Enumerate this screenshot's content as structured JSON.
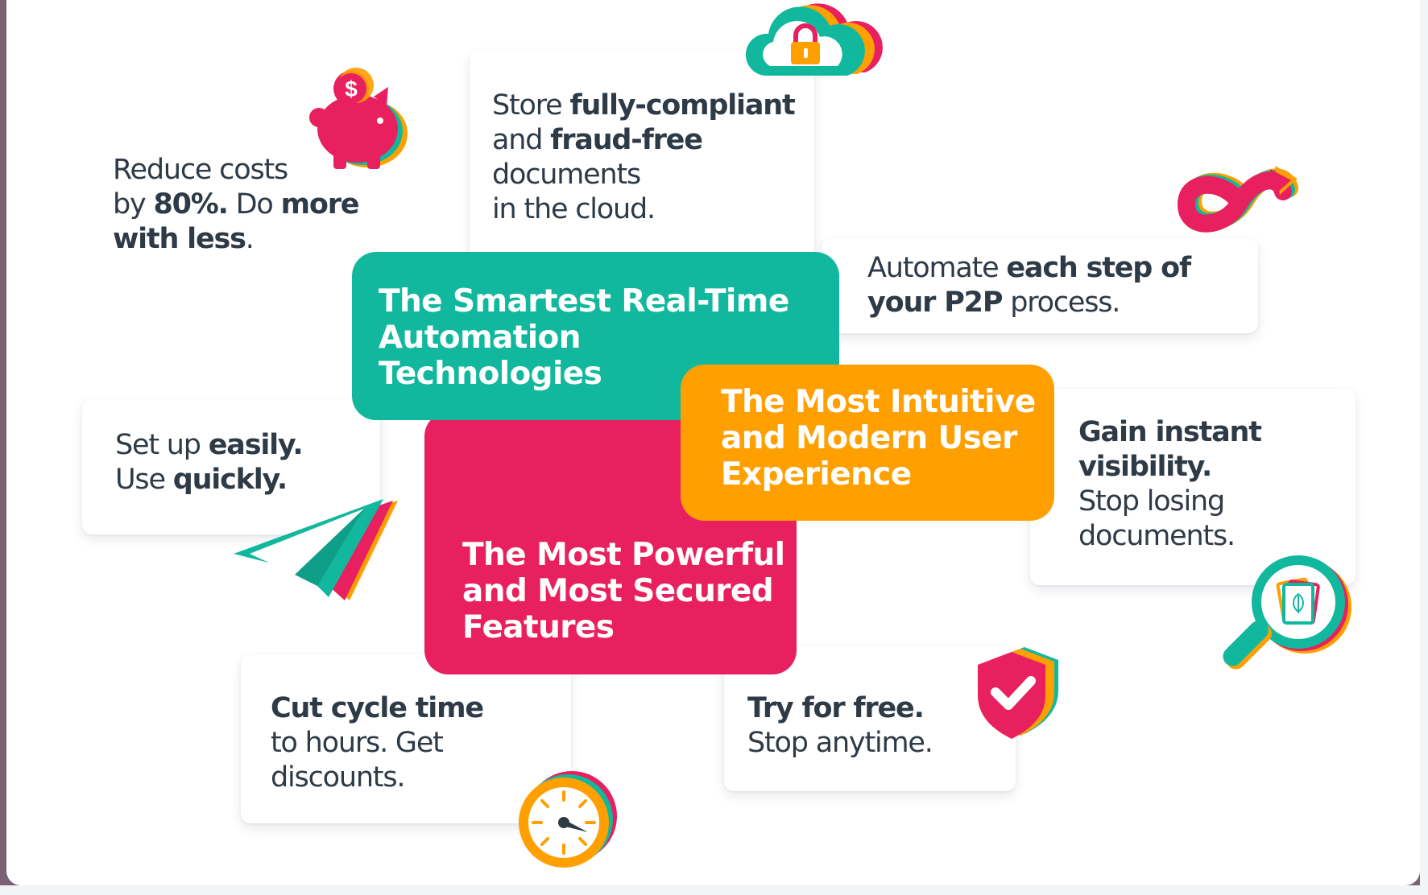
{
  "colors": {
    "teal": "#12b89d",
    "pink": "#e8205f",
    "orange": "#ff9f00",
    "text": "#2e3a46",
    "page_frame": "#7a6173"
  },
  "icons": [
    "piggy-bank-icon",
    "cloud-lock-icon",
    "infinity-arrow-icon",
    "paper-plane-icon",
    "magnifier-document-icon",
    "shield-check-icon",
    "speedometer-icon"
  ],
  "features": {
    "smartest": {
      "line1": "The Smartest Real-Time",
      "line2": "Automation",
      "line3": "Technologies"
    },
    "intuitive": {
      "line1": "The Most Intuitive",
      "line2": "and Modern User",
      "line3": "Experience"
    },
    "powerful": {
      "line1": "The Most Powerful",
      "line2": "and Most Secured",
      "line3": "Features"
    }
  },
  "benefits": {
    "reduce_costs": {
      "t1": "Reduce costs",
      "t2": "by ",
      "t3": "80%.",
      "t4": " Do ",
      "t5": "more",
      "t6": "with less",
      "t7": "."
    },
    "store": {
      "t1": "Store ",
      "t2": "fully-compliant",
      "t3": "and ",
      "t4": "fraud-free",
      "t5": "documents",
      "t6": "in the cloud."
    },
    "automate": {
      "t1": "Automate ",
      "t2": "each step of",
      "t3": "your P2P",
      "t4": " process."
    },
    "setup": {
      "t1": "Set up ",
      "t2": "easily.",
      "t3": "Use ",
      "t4": "quickly."
    },
    "visibility": {
      "t1": "Gain instant",
      "t2": "visibility.",
      "t3": "Stop losing",
      "t4": "documents."
    },
    "cycle": {
      "t1": "Cut cycle time",
      "t2": "to hours. Get",
      "t3": "discounts."
    },
    "free": {
      "t1": "Try for free.",
      "t2": "Stop anytime."
    }
  }
}
